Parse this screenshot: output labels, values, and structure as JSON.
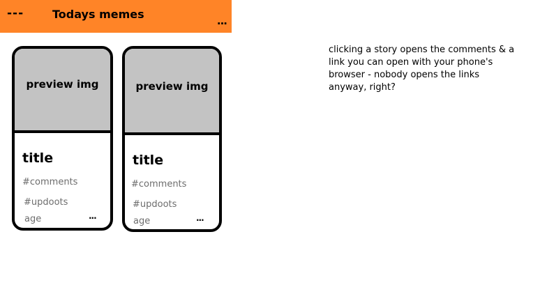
{
  "header": {
    "menu_icon": "---",
    "title": "Todays memes",
    "more_icon": "...",
    "background_color": "#ff8427"
  },
  "cards": [
    {
      "preview_label": "preview img",
      "title": "title",
      "comments": "#comments",
      "updoots": "#updoots",
      "age": "age",
      "more": "..."
    },
    {
      "preview_label": "preview img",
      "title": "title",
      "comments": "#comments",
      "updoots": "#updoots",
      "age": "age",
      "more": "..."
    }
  ],
  "annotation": "clicking a story opens the comments & a link you can open with your phone's browser - nobody opens the links anyway, right?",
  "colors": {
    "preview_fill": "#c3c3c3",
    "meta_text": "#6d6d6d"
  },
  "icons": {
    "menu": "hamburger-menu-icon",
    "more": "more-options-icon"
  }
}
